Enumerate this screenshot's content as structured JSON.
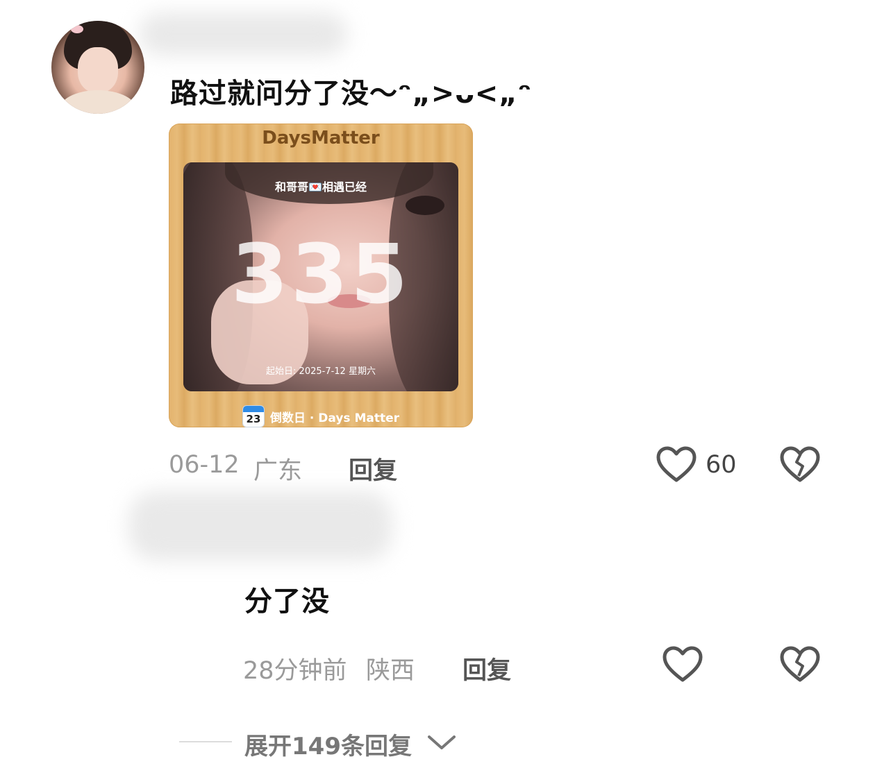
{
  "comment1": {
    "text": "路过就问分了没～ᵔ„>ᴗ<„ᵔ",
    "card": {
      "title": "DaysMatter",
      "caption": "和哥哥💌相遇已经",
      "days": "335",
      "start_date": "起始日: 2025-7-12 星期六",
      "cal_day": "23",
      "footer": "倒数日 · Days Matter"
    },
    "date": "06-12",
    "location": "广东",
    "reply_label": "回复",
    "like_count": "60"
  },
  "comment2": {
    "text": "分了没",
    "time": "28分钟前",
    "location": "陕西",
    "reply_label": "回复"
  },
  "expand": {
    "label": "展开149条回复"
  },
  "icons": {
    "like": "heart-outline-icon",
    "dislike": "broken-heart-icon",
    "expand": "chevron-down-icon"
  }
}
